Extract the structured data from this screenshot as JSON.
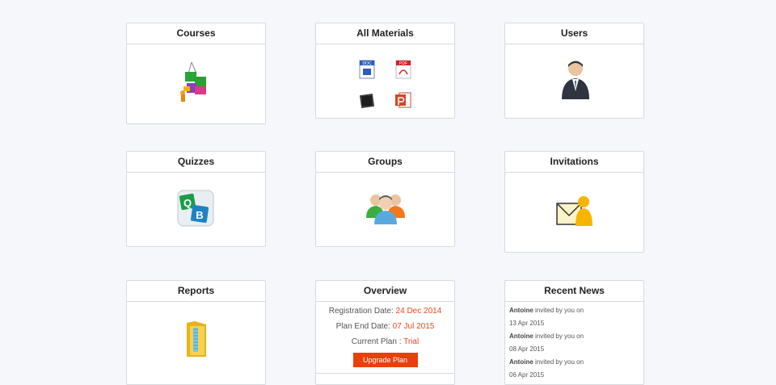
{
  "cards": {
    "courses": {
      "title": "Courses"
    },
    "materials": {
      "title": "All Materials",
      "doc_badge": "DOC",
      "pdf_badge": "PDF"
    },
    "users": {
      "title": "Users"
    },
    "quizzes": {
      "title": "Quizzes",
      "q_letter": "Q",
      "b_letter": "B"
    },
    "groups": {
      "title": "Groups"
    },
    "invitations": {
      "title": "Invitations"
    },
    "reports": {
      "title": "Reports"
    },
    "overview": {
      "title": "Overview",
      "registration_label": "Registration Date:",
      "registration_value": "24 Dec 2014",
      "plan_end_label": "Plan End Date:",
      "plan_end_value": "07 Jul 2015",
      "current_plan_label": "Current Plan :",
      "current_plan_value": "Trial",
      "upgrade_label": "Upgrade Plan"
    },
    "news": {
      "title": "Recent News",
      "items": [
        {
          "name": "Antoine",
          "text": "invited by you on",
          "date": "13 Apr 2015"
        },
        {
          "name": "Antoine",
          "text": "invited by you on",
          "date": "08 Apr 2015"
        },
        {
          "name": "Antoine",
          "text": "invited by you on",
          "date": "06 Apr 2015"
        }
      ]
    }
  },
  "colors": {
    "accent": "#ea3f0b",
    "highlight": "#e8491d"
  }
}
